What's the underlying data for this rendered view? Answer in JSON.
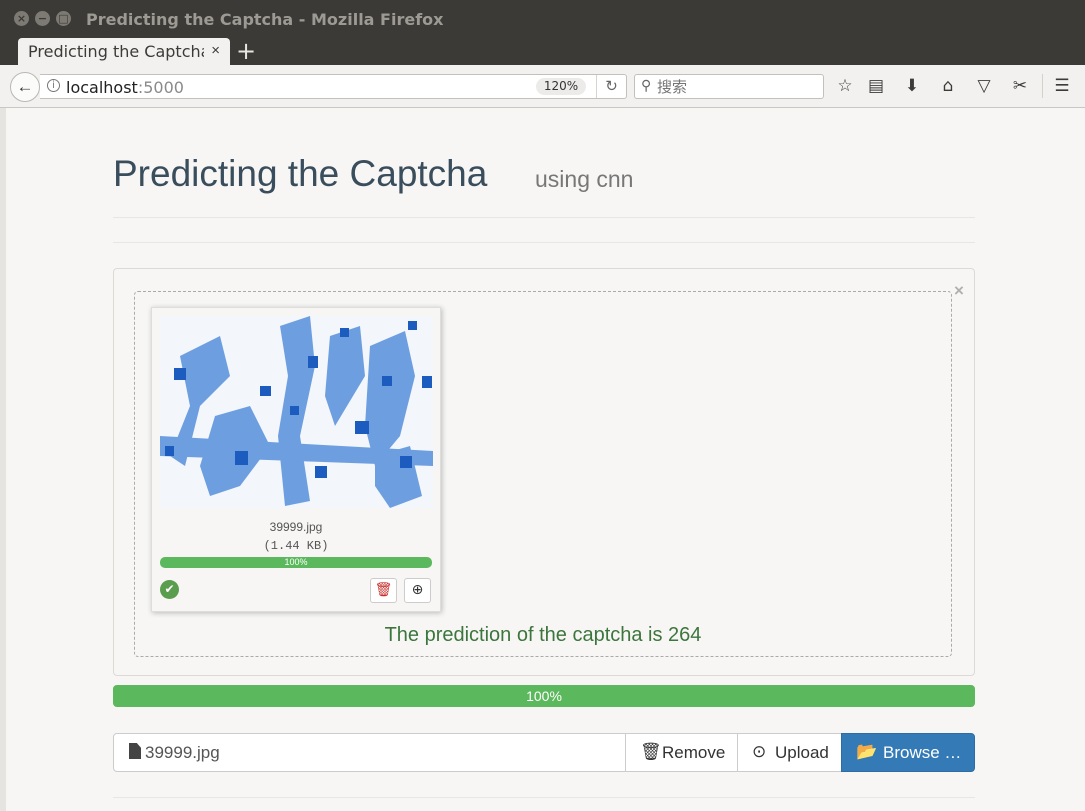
{
  "window": {
    "title": "Predicting the Captcha - Mozilla Firefox",
    "close_icon": "×",
    "minimize_icon": "−",
    "maximize_icon": "□"
  },
  "tab": {
    "label": "Predicting the Captcha",
    "close_icon": "×",
    "new_tab_icon": "+"
  },
  "nav": {
    "back_icon": "←",
    "info_icon": "i",
    "url_host": "localhost",
    "url_port": ":5000",
    "zoom": "120%",
    "reload_icon": "↻",
    "search_icon": "⚲",
    "search_placeholder": "搜索",
    "toolbar_icons": {
      "bookmark_star": "☆",
      "reading_list": "▤",
      "downloads": "⬇",
      "home": "⌂",
      "pocket": "▽",
      "screenshot": "✂",
      "menu": "☰"
    }
  },
  "page": {
    "title": "Predicting the Captcha",
    "subtitle": "using cnn",
    "panel_close": "×"
  },
  "thumbnail": {
    "file_name": "39999.jpg",
    "file_size": "(1.44 KB)",
    "progress_label": "100%",
    "progress": 1.0,
    "ok_icon": "✔",
    "delete_icon": "🗑",
    "zoom_icon": "⊕"
  },
  "prediction": "The prediction of the captcha is 264",
  "upload_progress": {
    "label": "100%",
    "value": 1.0
  },
  "file_input": {
    "caption": "39999.jpg",
    "remove_label": "Remove",
    "remove_icon": "🗑",
    "upload_label": "Upload",
    "upload_icon": "⊙",
    "browse_label": "Browse …",
    "browse_icon": "📂"
  },
  "colors": {
    "success": "#5cb85c",
    "primary": "#337ab7",
    "prediction_text": "#3c763d",
    "captcha_blue": "#2f6fd0"
  }
}
